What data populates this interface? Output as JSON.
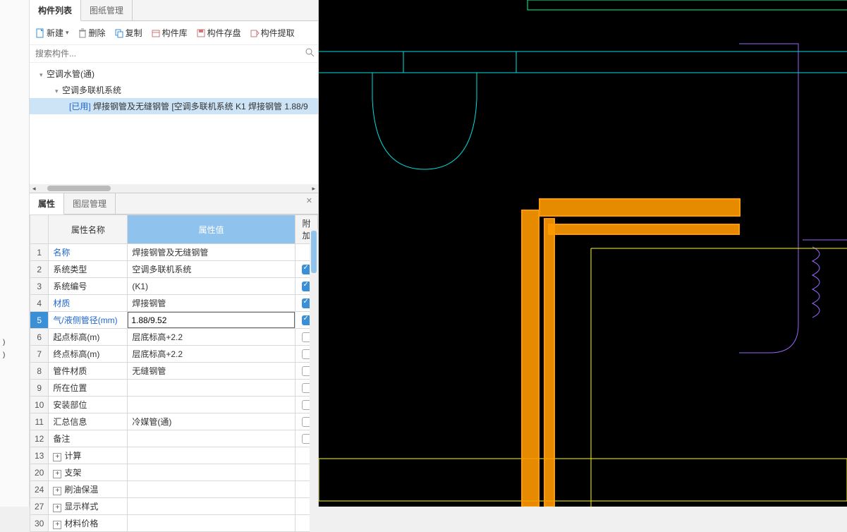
{
  "tabs_top": {
    "component_list": "构件列表",
    "drawing_mgmt": "图纸管理"
  },
  "toolbar": {
    "new": "新建",
    "delete": "删除",
    "copy": "复制",
    "lib": "构件库",
    "save": "构件存盘",
    "extract": "构件提取"
  },
  "search": {
    "placeholder": "搜索构件..."
  },
  "tree": {
    "items": [
      {
        "level": 0,
        "label": "空调水管(通)",
        "expanded": true
      },
      {
        "level": 1,
        "label": "空调多联机系统",
        "expanded": true
      },
      {
        "level": 2,
        "prefix": "[已用]",
        "label": "焊接钢管及无缝钢管 [空调多联机系统 K1 焊接钢管 1.88/9",
        "selected": true
      }
    ]
  },
  "tabs_bottom": {
    "props": "属性",
    "layer_mgmt": "图层管理"
  },
  "grid": {
    "headers": {
      "name": "属性名称",
      "value": "属性值",
      "add": "附加"
    },
    "rows": [
      {
        "n": "1",
        "name": "名称",
        "val": "焊接钢管及无缝钢管",
        "link": true
      },
      {
        "n": "2",
        "name": "系统类型",
        "val": "空调多联机系统",
        "chk": true
      },
      {
        "n": "3",
        "name": "系统编号",
        "val": "(K1)",
        "chk": true
      },
      {
        "n": "4",
        "name": "材质",
        "val": "焊接钢管",
        "link": true,
        "chk": true
      },
      {
        "n": "5",
        "name": "气/液侧管径(mm)",
        "val": "1.88/9.52",
        "link": true,
        "chk": true,
        "selected": true
      },
      {
        "n": "6",
        "name": "起点标高(m)",
        "val": "层底标高+2.2",
        "chk": false
      },
      {
        "n": "7",
        "name": "终点标高(m)",
        "val": "层底标高+2.2",
        "chk": false
      },
      {
        "n": "8",
        "name": "管件材质",
        "val": "无缝钢管",
        "chk": false
      },
      {
        "n": "9",
        "name": "所在位置",
        "val": "",
        "chk": false
      },
      {
        "n": "10",
        "name": "安装部位",
        "val": "",
        "chk": false
      },
      {
        "n": "11",
        "name": "汇总信息",
        "val": "冷媒管(通)",
        "chk": false
      },
      {
        "n": "12",
        "name": "备注",
        "val": "",
        "chk": false
      },
      {
        "n": "13",
        "name": "计算",
        "exp": true
      },
      {
        "n": "20",
        "name": "支架",
        "exp": true
      },
      {
        "n": "24",
        "name": "刷油保温",
        "exp": true
      },
      {
        "n": "27",
        "name": "显示样式",
        "exp": true
      },
      {
        "n": "30",
        "name": "材料价格",
        "exp": true
      }
    ]
  }
}
